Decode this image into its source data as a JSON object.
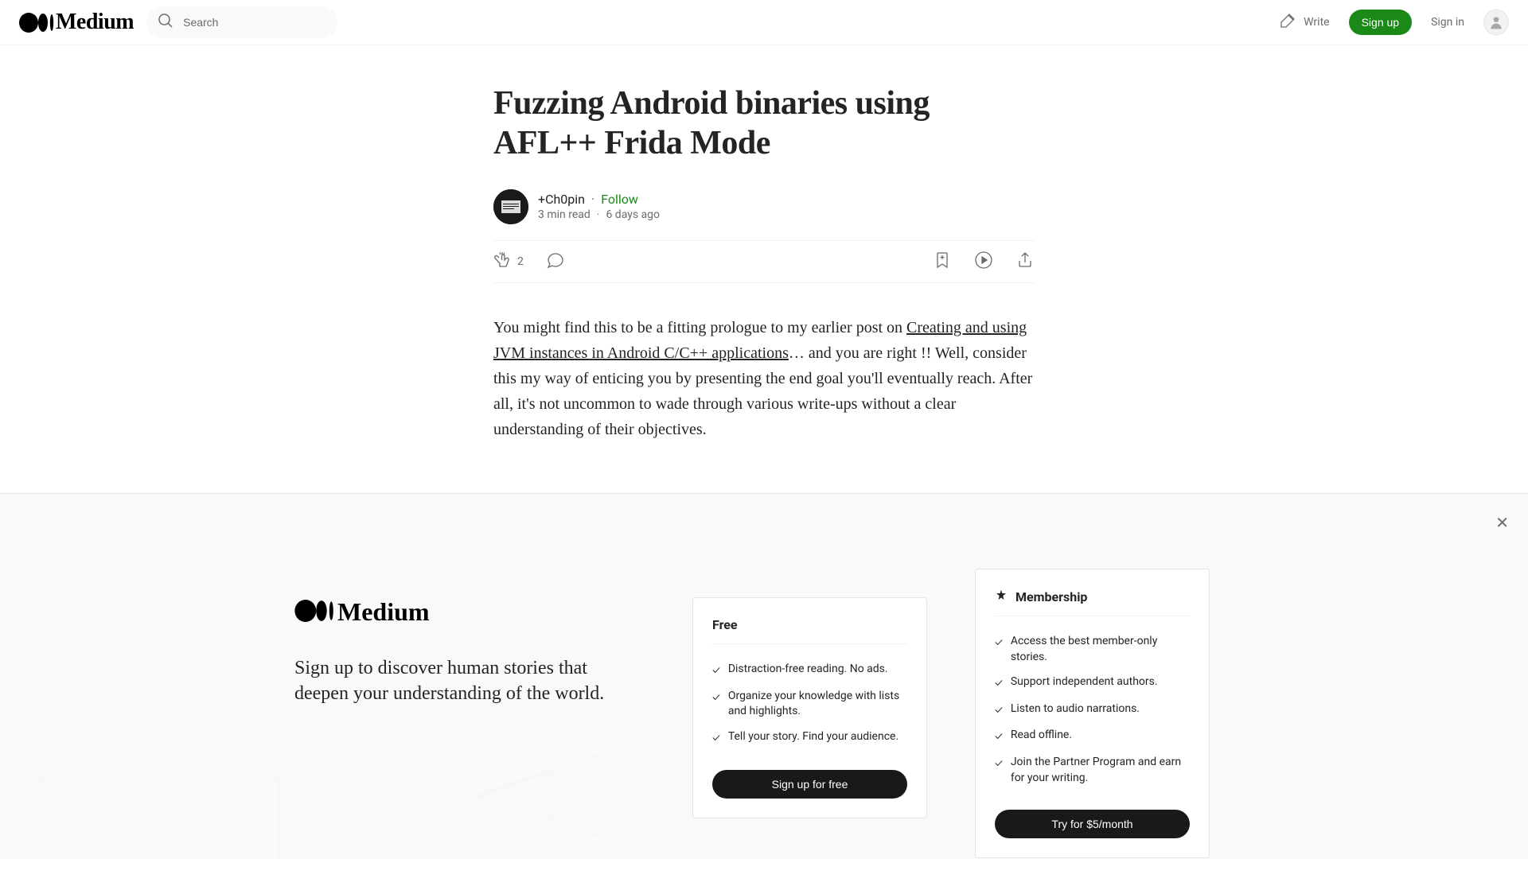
{
  "header": {
    "search_placeholder": "Search",
    "write_label": "Write",
    "signup_label": "Sign up",
    "signin_label": "Sign in"
  },
  "article": {
    "title": "Fuzzing Android binaries using AFL++ Frida Mode",
    "author": "+Ch0pin",
    "follow_label": "Follow",
    "read_time": "3 min read",
    "published": "6 days ago",
    "clap_count": "2",
    "body_prefix": "You might find this to be a fitting prologue to my earlier post on ",
    "body_link": "Creating and using JVM instances in Android C/C++ applications",
    "body_suffix": "… and you are right !! Well, consider this my way of enticing you by presenting the end goal you'll eventually reach. After all, it's not uncommon to wade through various write-ups without a clear understanding of their objectives."
  },
  "overlay": {
    "tagline": "Sign up to discover human stories that deepen your understanding of the world.",
    "free": {
      "title": "Free",
      "items": [
        "Distraction-free reading. No ads.",
        "Organize your knowledge with lists and highlights.",
        "Tell your story. Find your audience."
      ],
      "button": "Sign up for free"
    },
    "membership": {
      "title": "Membership",
      "items": [
        "Access the best member-only stories.",
        "Support independent authors.",
        "Listen to audio narrations.",
        "Read offline.",
        "Join the Partner Program and earn for your writing."
      ],
      "button": "Try for $5/month"
    }
  }
}
